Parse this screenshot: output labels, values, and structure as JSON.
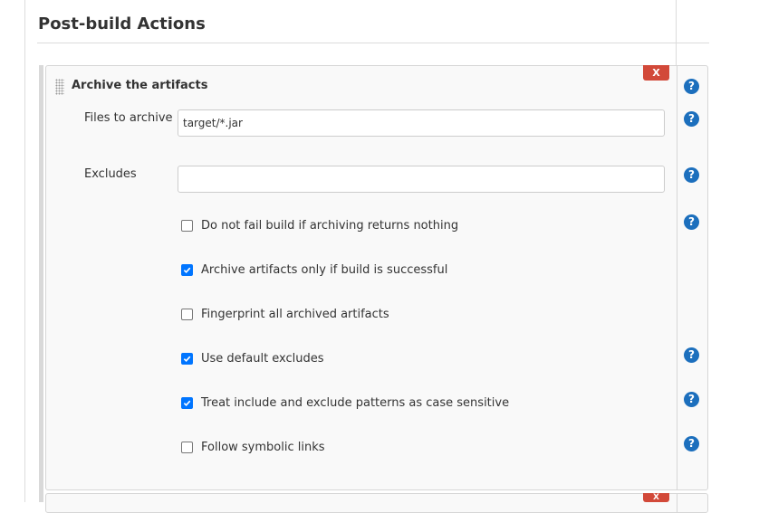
{
  "section": {
    "title": "Post-build Actions"
  },
  "archive": {
    "title": "Archive the artifacts",
    "delete_label": "X",
    "files_to_archive": {
      "label": "Files to archive",
      "value": "target/*.jar"
    },
    "excludes": {
      "label": "Excludes",
      "value": ""
    },
    "options": [
      {
        "label": "Do not fail build if archiving returns nothing",
        "checked": false,
        "help": true
      },
      {
        "label": "Archive artifacts only if build is successful",
        "checked": true,
        "help": false
      },
      {
        "label": "Fingerprint all archived artifacts",
        "checked": false,
        "help": false
      },
      {
        "label": "Use default excludes",
        "checked": true,
        "help": true
      },
      {
        "label": "Treat include and exclude patterns as case sensitive",
        "checked": true,
        "help": true
      },
      {
        "label": "Follow symbolic links",
        "checked": false,
        "help": true
      }
    ]
  },
  "help_glyph": "?",
  "colors": {
    "delete": "#d24939",
    "help": "#1c6fbd",
    "checkbox_checked": "#0075ff"
  },
  "icons": {
    "drag": "drag-handle-icon",
    "help": "help-icon",
    "check": "checkmark-icon"
  }
}
